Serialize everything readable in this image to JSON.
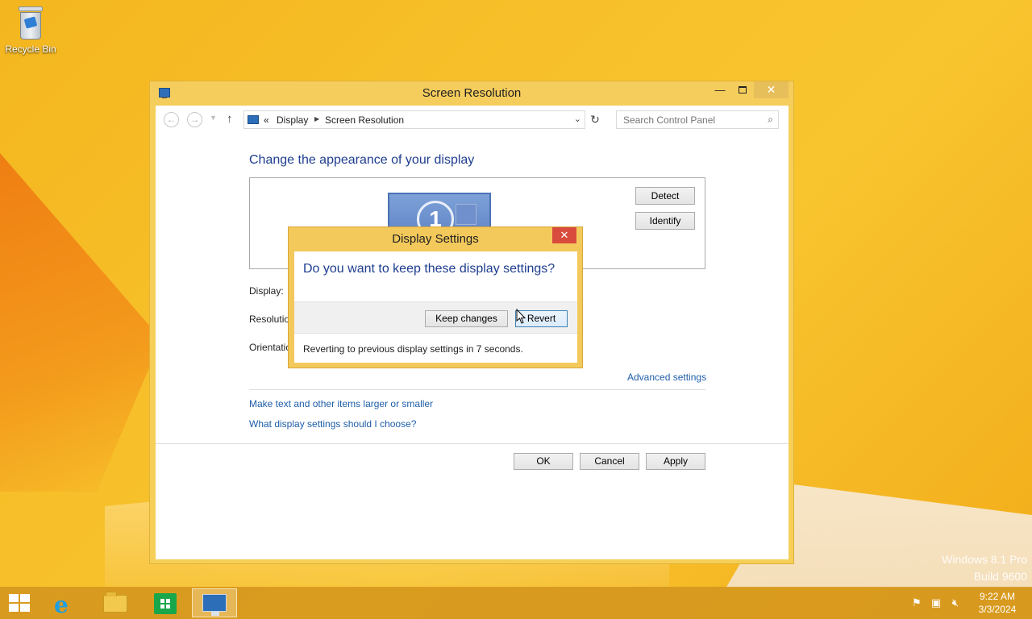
{
  "desktop": {
    "recycle_bin_label": "Recycle Bin",
    "watermark_line1": "Windows 8.1 Pro",
    "watermark_line2": "Build 9600"
  },
  "window": {
    "title": "Screen Resolution",
    "minimize_glyph": "—",
    "close_glyph": "✕",
    "address": {
      "overflow": "«",
      "crumbs": [
        "Display",
        "Screen Resolution"
      ]
    },
    "search_placeholder": "Search Control Panel",
    "heading": "Change the appearance of your display",
    "monitor_number": "1",
    "buttons": {
      "detect": "Detect",
      "identify": "Identify",
      "ok": "OK",
      "cancel": "Cancel",
      "apply": "Apply"
    },
    "labels": {
      "display": "Display:",
      "resolution": "Resolutio",
      "orientation": "Orientatic"
    },
    "links": {
      "advanced": "Advanced settings",
      "text_size": "Make text and other items larger or smaller",
      "choose": "What display settings should I choose?"
    }
  },
  "dialog": {
    "title": "Display Settings",
    "close_glyph": "✕",
    "question": "Do you want to keep these display settings?",
    "keep_label": "Keep changes",
    "revert_label": "Revert",
    "status": "Reverting to previous display settings in 7 seconds."
  },
  "taskbar": {
    "time": "9:22 AM",
    "date": "3/3/2024"
  }
}
